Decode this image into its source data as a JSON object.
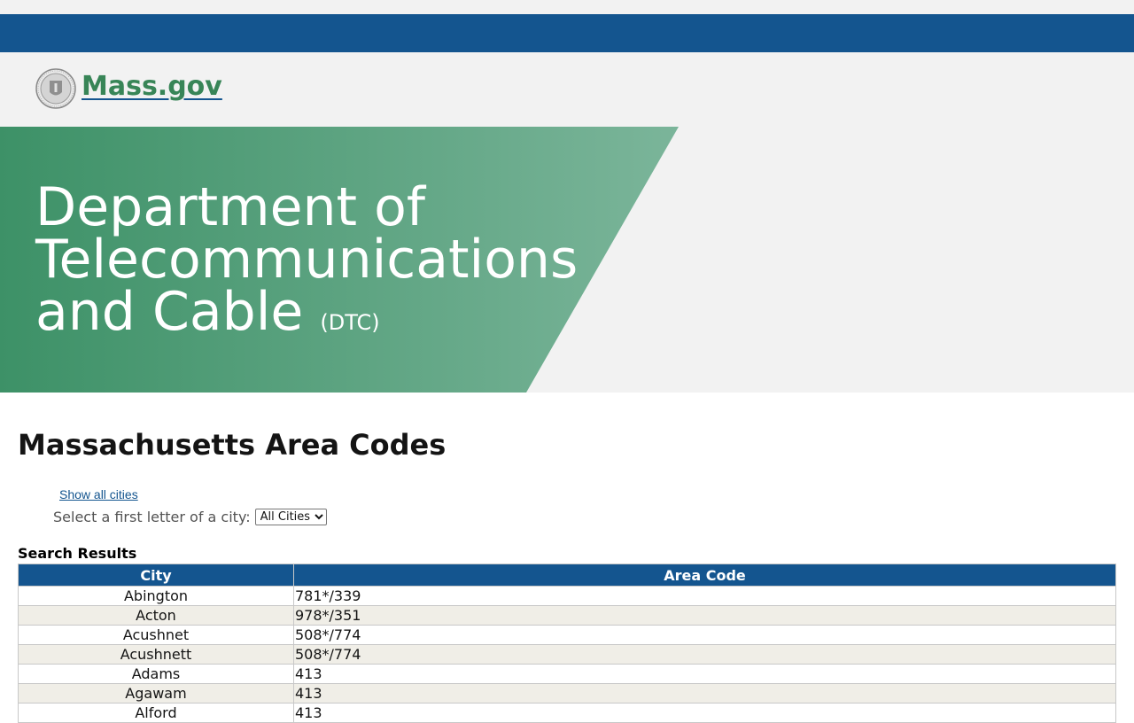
{
  "header": {
    "logo_text": "Mass.gov",
    "seal_icon": "massachusetts-seal-icon"
  },
  "hero": {
    "title_line1": "Department of",
    "title_line2": "Telecommunications",
    "title_line3": "and Cable",
    "abbr": "(DTC)",
    "colors": {
      "green_dark": "#3d9167",
      "green_light": "#7bb59a"
    }
  },
  "main": {
    "page_title": "Massachusetts Area Codes",
    "show_all_link": "Show all cities",
    "select_label": "Select a first letter of a city:",
    "select_value": "All Cities",
    "results_label": "Search Results",
    "table": {
      "headers": [
        "City",
        "Area Code"
      ],
      "rows": [
        {
          "city": "Abington",
          "code": "781*/339"
        },
        {
          "city": "Acton",
          "code": "978*/351"
        },
        {
          "city": "Acushnet",
          "code": "508*/774"
        },
        {
          "city": "Acushnett",
          "code": "508*/774"
        },
        {
          "city": "Adams",
          "code": "413"
        },
        {
          "city": "Agawam",
          "code": "413"
        },
        {
          "city": "Alford",
          "code": "413"
        }
      ]
    }
  },
  "colors": {
    "brand_blue": "#14558f",
    "brand_green": "#388557",
    "row_alt": "#f0eee7"
  }
}
